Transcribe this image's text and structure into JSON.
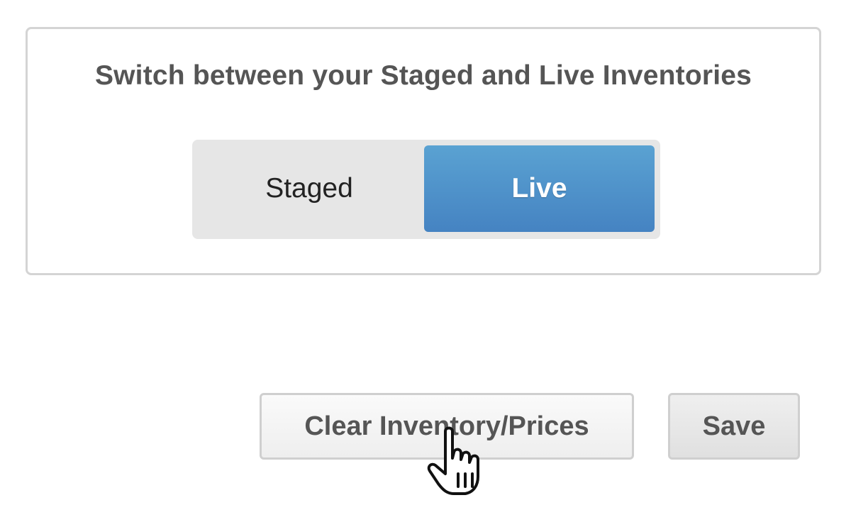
{
  "inventory_panel": {
    "title": "Switch between your Staged and Live Inventories",
    "toggle": {
      "options": [
        {
          "label": "Staged",
          "selected": false
        },
        {
          "label": "Live",
          "selected": true
        }
      ],
      "active_color": "#4a8cc8"
    }
  },
  "actions": {
    "clear_label": "Clear Inventory/Prices",
    "save_label": "Save"
  },
  "cursor": {
    "icon": "hand-pointer-icon"
  }
}
